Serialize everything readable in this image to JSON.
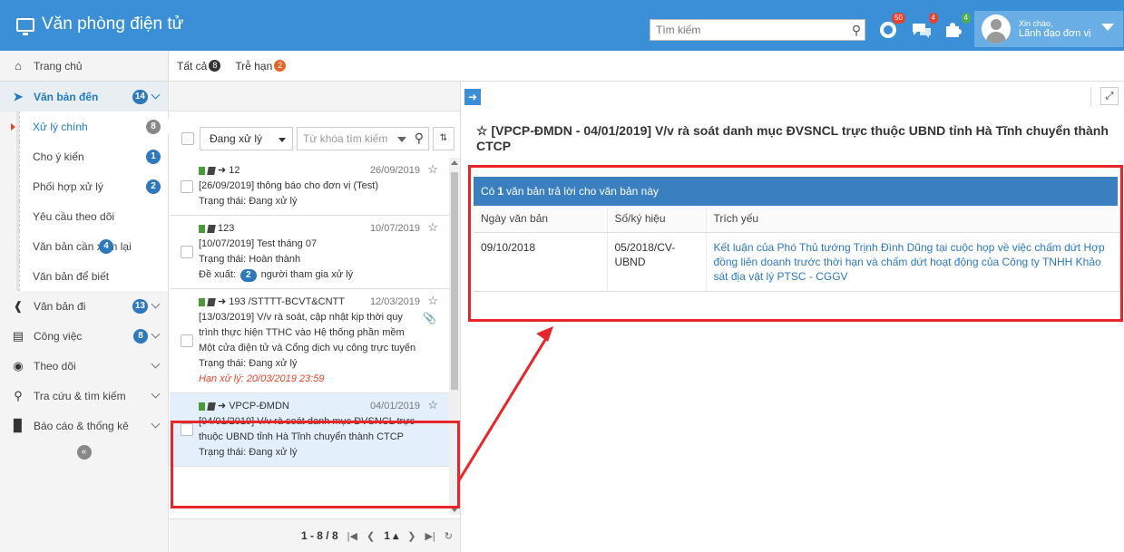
{
  "header": {
    "app_title": "Văn phòng điện tử",
    "search_placeholder": "Tìm kiếm",
    "notif_badges": [
      "50",
      "4",
      "4"
    ],
    "greeting": "Xin chào,",
    "user_name": "Lãnh đạo đơn vị"
  },
  "sidebar": {
    "home": "Trang chủ",
    "incoming": {
      "label": "Văn bản đến",
      "count": "14"
    },
    "sub_items": [
      {
        "label": "Xử lý chính",
        "count": "8"
      },
      {
        "label": "Cho ý kiến",
        "count": "1"
      },
      {
        "label": "Phối hợp xử lý",
        "count": "2"
      },
      {
        "label": "Yêu cầu theo dõi",
        "count": ""
      },
      {
        "label": "Văn bản cần xem lại",
        "count": "4"
      },
      {
        "label": "Văn bản để biết",
        "count": ""
      }
    ],
    "outgoing": {
      "label": "Văn bản đi",
      "count": "13"
    },
    "tasks": {
      "label": "Công việc",
      "count": "8"
    },
    "follow": {
      "label": "Theo dõi"
    },
    "lookup": {
      "label": "Tra cứu & tìm kiếm"
    },
    "reports": {
      "label": "Báo cáo & thống kê"
    }
  },
  "tabs": [
    {
      "label": "Tất cả",
      "badge": "8"
    },
    {
      "label": "Trễ hạn",
      "badge": "2"
    }
  ],
  "filter": {
    "status_select": "Đang xử lý",
    "keyword_placeholder": "Từ khóa tìm kiếm"
  },
  "list_items": [
    {
      "code": "12",
      "date": "26/09/2019",
      "summary": "[26/09/2019] thông báo cho đơn vị (Test)",
      "status": "Trạng thái: Đang xử lý"
    },
    {
      "code": "123",
      "date": "10/07/2019",
      "summary": "[10/07/2019] Test tháng 07",
      "status": "Trạng thái: Hoàn thành",
      "proposal_prefix": "Đề xuất:",
      "proposal_count": "2",
      "proposal_suffix": "người tham gia xử lý"
    },
    {
      "code": "193 /STTTT-BCVT&CNTT",
      "date": "12/03/2019",
      "summary": "[13/03/2019] V/v rà soát, cập nhật kịp thời quy trình thực hiện TTHC vào Hệ thống phần mềm Một cửa điện tử và Cổng dịch vụ công trực tuyến",
      "status": "Trạng thái: Đang xử lý",
      "deadline": "Hạn xử lý: 20/03/2019 23:59"
    },
    {
      "code": "VPCP-ĐMDN",
      "date": "04/01/2019",
      "summary": "[04/01/2019] V/v rà soát danh mục ĐVSNCL trực thuộc UBND tỉnh Hà Tĩnh chuyển thành CTCP",
      "status": "Trạng thái: Đang xử lý"
    }
  ],
  "pager": {
    "range": "1 - 8 / 8",
    "page": "1"
  },
  "detail": {
    "title": "[VPCP-ĐMDN - 04/01/2019] V/v rà soát danh mục ĐVSNCL trực thuộc UBND tỉnh Hà Tĩnh chuyển thành CTCP",
    "reply_prefix": "Có",
    "reply_count": "1",
    "reply_suffix": "văn bản trả lời cho văn bản này",
    "columns": [
      "Ngày văn bản",
      "Số/ký hiệu",
      "Trích yếu"
    ],
    "rows": [
      {
        "date": "09/10/2018",
        "number": "05/2018/CV-UBND",
        "summary": "Kết luận của Phó Thủ tướng Trịnh Đình Dũng tại cuộc họp về việc chấm dứt Hợp đồng liên doanh trước thời hạn và chấm dứt hoạt động của Công ty TNHH Khảo sát địa vật lý PTSC - CGGV"
      }
    ]
  },
  "colors": {
    "primary": "#3a8fd6",
    "highlight": "#e8252a",
    "badge": "#2e78bd"
  }
}
